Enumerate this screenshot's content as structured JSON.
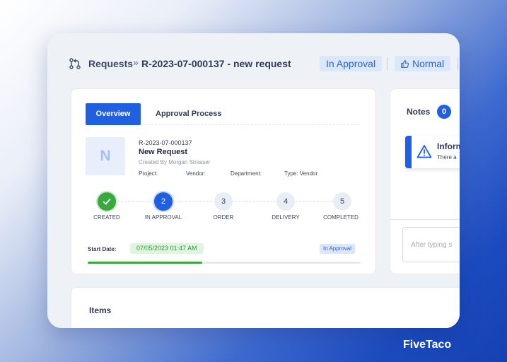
{
  "header": {
    "requests_label": "Requests",
    "separator": "»",
    "request_title": "R-2023-07-000137 - new request",
    "status_badge": "In Approval",
    "priority_badge": "Normal"
  },
  "tabs": [
    {
      "label": "Overview",
      "active": true
    },
    {
      "label": "Approval Process",
      "active": false
    }
  ],
  "request": {
    "avatar_letter": "N",
    "number": "R-2023-07-000137",
    "title": "New Request",
    "created_by": "Created By Morgan Strasser",
    "meta": [
      {
        "label": "Project:"
      },
      {
        "label": "Vendor:"
      },
      {
        "label": "Department:"
      },
      {
        "label": "Type: Vendor"
      }
    ]
  },
  "steps": [
    {
      "number": "",
      "label": "CREATED",
      "state": "done"
    },
    {
      "number": "2",
      "label": "IN APPROVAL",
      "state": "active"
    },
    {
      "number": "3",
      "label": "ORDER",
      "state": "todo"
    },
    {
      "number": "4",
      "label": "DELIVERY",
      "state": "todo"
    },
    {
      "number": "5",
      "label": "COMPLETED",
      "state": "todo"
    }
  ],
  "timeline": {
    "start_label": "Start Date:",
    "start_date": "07/05/2023 01:47 AM",
    "status": "In Approval",
    "progress_percent": 42
  },
  "notes": {
    "title": "Notes",
    "count": "0",
    "info_title": "Inform",
    "info_text": "There a",
    "input_placeholder": "After typing s"
  },
  "items": {
    "title": "Items"
  },
  "brand": "FiveTaco",
  "colors": {
    "primary": "#1f5fe0",
    "success": "#39a93d",
    "badge_bg": "#dbe7fb",
    "badge_text": "#2f62c9"
  }
}
